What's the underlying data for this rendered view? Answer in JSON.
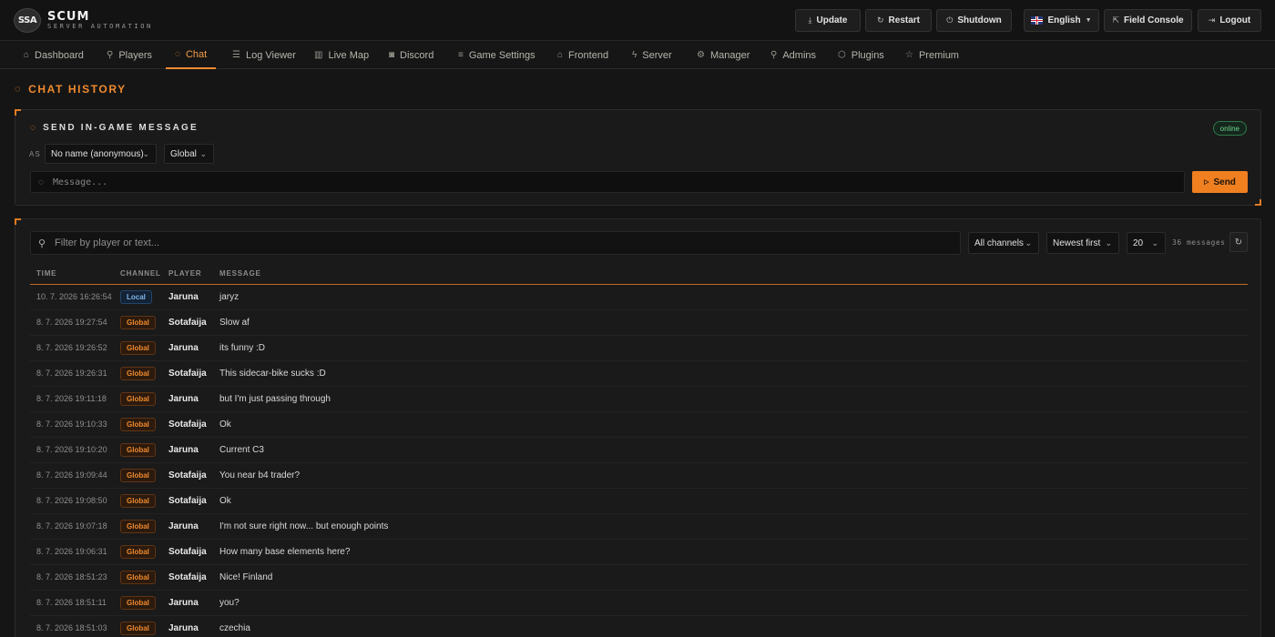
{
  "app": {
    "logo_badge": "SSA",
    "title": "SCUM",
    "subtitle": "SERVER AUTOMATION"
  },
  "topbar": {
    "update": "Update",
    "restart": "Restart",
    "shutdown": "Shutdown",
    "language": "English",
    "field_console": "Field Console",
    "logout": "Logout"
  },
  "nav": [
    {
      "label": "Dashboard",
      "icon": "home-icon"
    },
    {
      "label": "Players",
      "icon": "user-icon"
    },
    {
      "label": "Chat",
      "icon": "chat-icon",
      "active": true
    },
    {
      "label": "Log Viewer",
      "icon": "list-icon"
    },
    {
      "label": "Live Map",
      "icon": "map-icon"
    },
    {
      "label": "Discord",
      "icon": "discord-icon"
    },
    {
      "label": "Game Settings",
      "icon": "sliders-icon"
    },
    {
      "label": "Frontend",
      "icon": "building-icon"
    },
    {
      "label": "Server",
      "icon": "bolt-icon"
    },
    {
      "label": "Manager",
      "icon": "gear-icon"
    },
    {
      "label": "Admins",
      "icon": "admin-icon"
    },
    {
      "label": "Plugins",
      "icon": "cube-icon"
    },
    {
      "label": "Premium",
      "icon": "star-icon"
    }
  ],
  "page": {
    "title": "CHAT HISTORY"
  },
  "send": {
    "title": "SEND IN-GAME MESSAGE",
    "status": "online",
    "as_label": "AS",
    "sender": "No name (anonymous)",
    "channel": "Global",
    "placeholder": "Message...",
    "button": "Send"
  },
  "history": {
    "filter_placeholder": "Filter by player or text...",
    "channel_filter": "All channels",
    "sort": "Newest first",
    "page_size": "20",
    "count": "36 messages",
    "columns": {
      "time": "TIME",
      "channel": "CHANNEL",
      "player": "PLAYER",
      "message": "MESSAGE"
    },
    "rows": [
      {
        "time": "10. 7. 2026 16:26:54",
        "channel": "Local",
        "player": "Jaruna",
        "message": "jaryz"
      },
      {
        "time": "8. 7. 2026 19:27:54",
        "channel": "Global",
        "player": "Sotafaija",
        "message": "Slow af"
      },
      {
        "time": "8. 7. 2026 19:26:52",
        "channel": "Global",
        "player": "Jaruna",
        "message": "its funny :D"
      },
      {
        "time": "8. 7. 2026 19:26:31",
        "channel": "Global",
        "player": "Sotafaija",
        "message": "This sidecar-bike sucks :D"
      },
      {
        "time": "8. 7. 2026 19:11:18",
        "channel": "Global",
        "player": "Jaruna",
        "message": "but I'm just passing through"
      },
      {
        "time": "8. 7. 2026 19:10:33",
        "channel": "Global",
        "player": "Sotafaija",
        "message": "Ok"
      },
      {
        "time": "8. 7. 2026 19:10:20",
        "channel": "Global",
        "player": "Jaruna",
        "message": "Current C3"
      },
      {
        "time": "8. 7. 2026 19:09:44",
        "channel": "Global",
        "player": "Sotafaija",
        "message": "You near b4 trader?"
      },
      {
        "time": "8. 7. 2026 19:08:50",
        "channel": "Global",
        "player": "Sotafaija",
        "message": "Ok"
      },
      {
        "time": "8. 7. 2026 19:07:18",
        "channel": "Global",
        "player": "Jaruna",
        "message": "I'm not sure right now... but enough points"
      },
      {
        "time": "8. 7. 2026 19:06:31",
        "channel": "Global",
        "player": "Sotafaija",
        "message": "How many base elements here?"
      },
      {
        "time": "8. 7. 2026 18:51:23",
        "channel": "Global",
        "player": "Sotafaija",
        "message": "Nice! Finland"
      },
      {
        "time": "8. 7. 2026 18:51:11",
        "channel": "Global",
        "player": "Jaruna",
        "message": "you?"
      },
      {
        "time": "8. 7. 2026 18:51:03",
        "channel": "Global",
        "player": "Jaruna",
        "message": "czechia"
      }
    ]
  },
  "colors": {
    "accent": "#f08a2e",
    "background": "#151515",
    "panel": "#1a1a1a",
    "online": "#6fd68f",
    "local_channel": "#7fb4ec"
  }
}
